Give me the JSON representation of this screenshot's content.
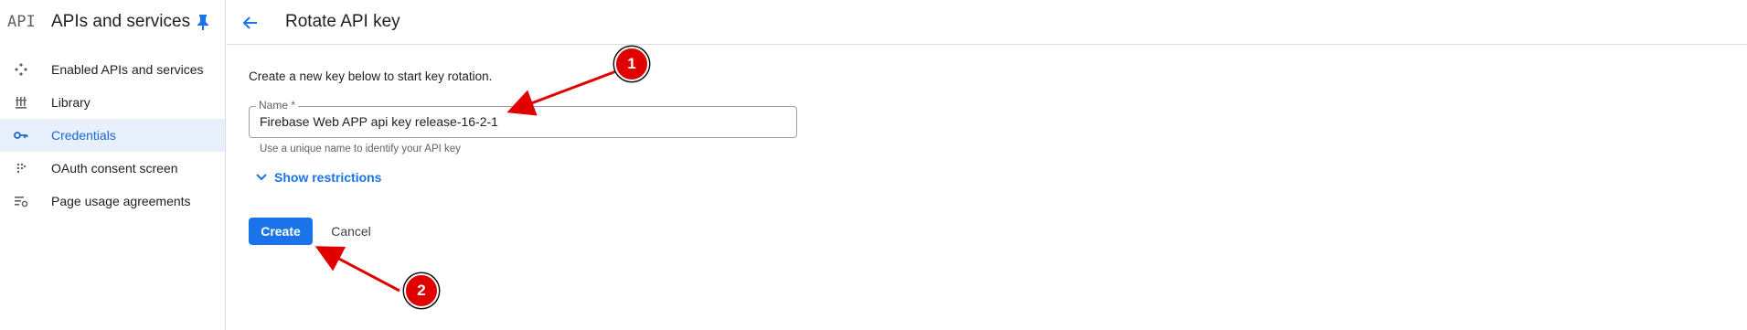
{
  "sidebar": {
    "logo": "API",
    "title": "APIs and services",
    "items": [
      {
        "label": "Enabled APIs and services",
        "icon": "enabled-apis-icon"
      },
      {
        "label": "Library",
        "icon": "library-icon"
      },
      {
        "label": "Credentials",
        "icon": "key-icon",
        "active": true
      },
      {
        "label": "OAuth consent screen",
        "icon": "oauth-icon"
      },
      {
        "label": "Page usage agreements",
        "icon": "agreements-icon"
      }
    ]
  },
  "header": {
    "title": "Rotate API key"
  },
  "form": {
    "intro": "Create a new key below to start key rotation.",
    "name_label": "Name *",
    "name_value": "Firebase Web APP api key release-16-2-1",
    "name_hint": "Use a unique name to identify your API key",
    "show_restrictions": "Show restrictions",
    "create_label": "Create",
    "cancel_label": "Cancel"
  },
  "annotations": {
    "badge1": "1",
    "badge2": "2"
  },
  "colors": {
    "accent": "#1a73e8",
    "active_bg": "#e8f0fe",
    "annotation": "#e00000"
  }
}
